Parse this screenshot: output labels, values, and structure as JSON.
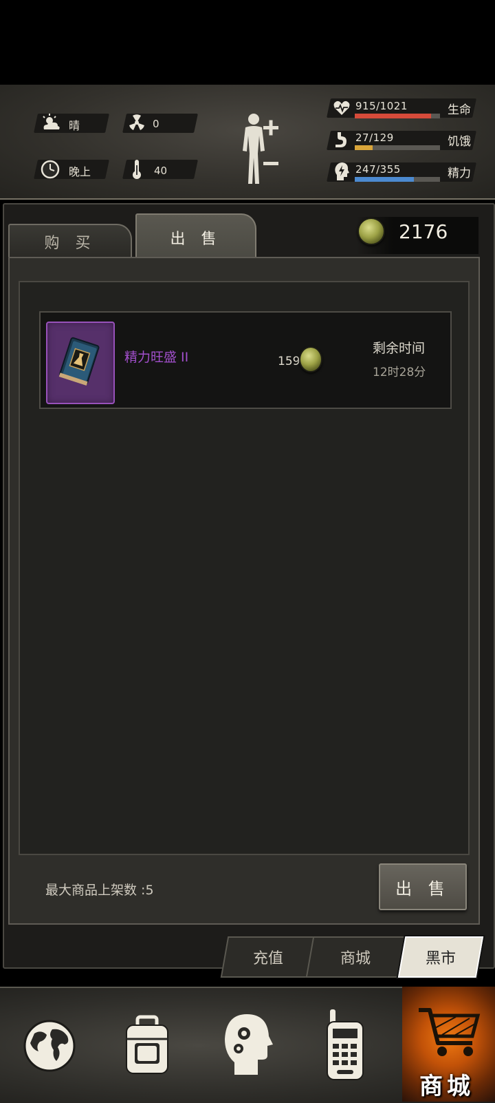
{
  "status": {
    "weather": "晴",
    "radiation": "0",
    "time_of_day": "晚上",
    "temperature": "40",
    "health": {
      "label": "生命",
      "value": "915/1021",
      "fill": 0.896,
      "color": "#d64b3a"
    },
    "hunger": {
      "label": "饥饿",
      "value": "27/129",
      "fill": 0.209,
      "color": "#d9a53a"
    },
    "energy": {
      "label": "精力",
      "value": "247/355",
      "fill": 0.696,
      "color": "#4c8ad0"
    }
  },
  "tabs": {
    "buy": "购 买",
    "sell": "出 售"
  },
  "currency": {
    "amount": "2176"
  },
  "listing": {
    "name": "精力旺盛 II",
    "price": "159",
    "remaining_label": "剩余时间",
    "remaining_value": "12时28分"
  },
  "footer": {
    "max_listings": "最大商品上架数 :5",
    "sell_button": "出 售"
  },
  "subtabs": {
    "recharge": "充值",
    "mall": "商城",
    "black_market": "黑市"
  },
  "nav": {
    "mall_label": "商城"
  }
}
